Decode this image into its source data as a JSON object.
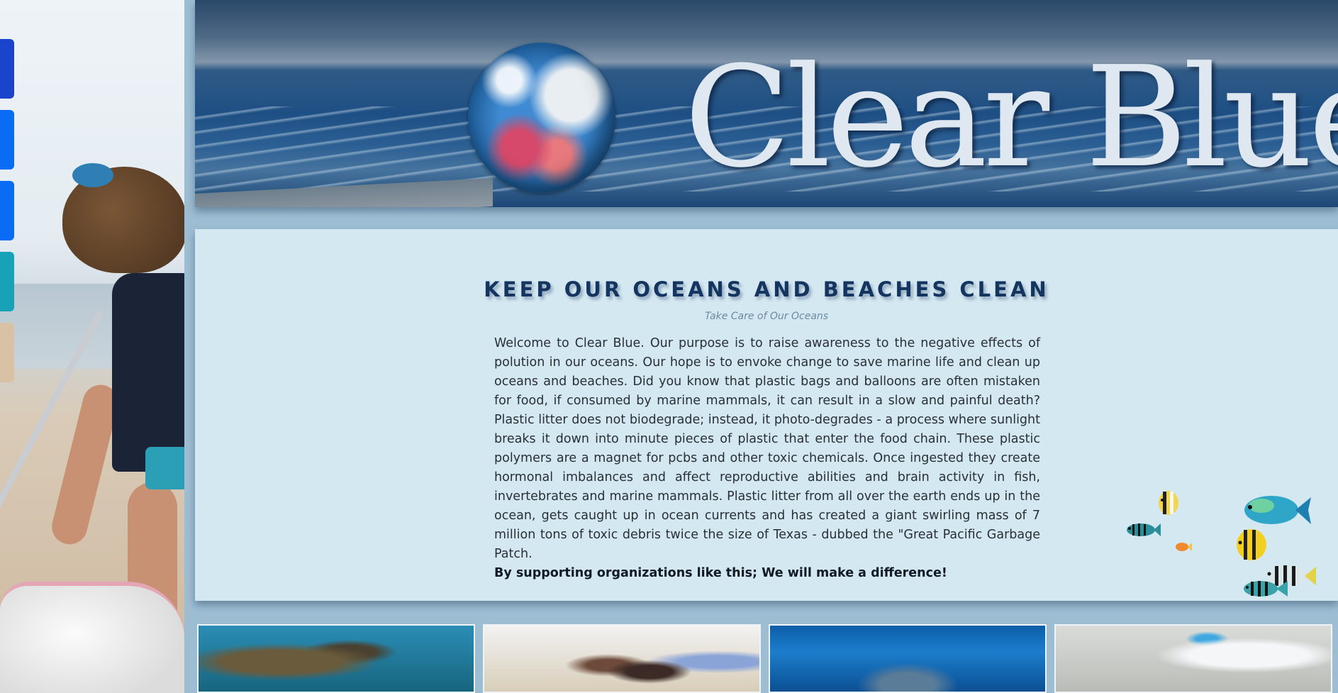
{
  "site": {
    "title": "Clear Blue"
  },
  "side_nav": {
    "buttons": [
      {
        "name": "nav-button-1",
        "color": "#1a44cc"
      },
      {
        "name": "nav-button-2",
        "color": "#0a6cf5"
      },
      {
        "name": "nav-button-3",
        "color": "#0a6cf5"
      },
      {
        "name": "nav-button-4",
        "color": "#17a2b8"
      },
      {
        "name": "nav-button-5",
        "color": "#d9c1a6"
      }
    ]
  },
  "main": {
    "headline": "KEEP OUR OCEANS AND BEACHES CLEAN",
    "subheadline": "Take Care of Our Oceans",
    "body": "Welcome to Clear Blue. Our purpose is to raise awareness to the negative effects of polution in our oceans. Our hope is to envoke change to save marine life and clean up oceans and beaches. Did you know that plastic bags and balloons are often mistaken for food, if consumed by marine mammals, it can result in a slow and painful death? Plastic litter does not biodegrade; instead, it photo-degrades - a process where sunlight breaks it down into minute pieces of plastic that enter the food chain. These plastic polymers are a magnet for pcbs and other toxic chemicals. Once ingested they create hormonal imbalances and affect reproductive abilities and brain activity in fish, invertebrates and marine mammals. Plastic litter from all over the earth ends up in the ocean, gets caught up in ocean currents and has created a giant swirling mass of 7 million tons of toxic debris twice the size of Texas - dubbed the \"Great Pacific Garbage Patch.",
    "call_to_action": "By supporting organizations like this; We will make a difference!"
  },
  "colors": {
    "page_bg": "#9dbdd3",
    "panel_bg": "#d4e8f2",
    "headline": "#14355f",
    "subheadline": "#6c8aa1"
  }
}
